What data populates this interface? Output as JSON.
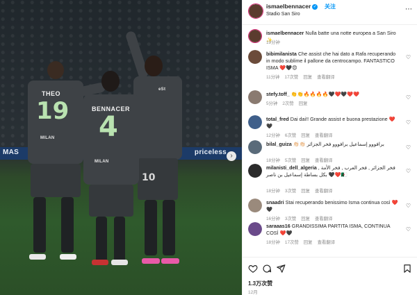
{
  "photo": {
    "board_left": "MAS",
    "board_right": "priceless",
    "players": {
      "left": {
        "name": "THEO",
        "number": "19",
        "sponsor": "MILAN"
      },
      "center": {
        "name": "BENNACER",
        "number": "4",
        "sponsor": "MILAN"
      },
      "right": {
        "number": "10",
        "sponsor": "eSt"
      }
    }
  },
  "header": {
    "username": "ismaelbennacer",
    "follow_label": "关注",
    "location": "Stadio San Siro"
  },
  "caption": {
    "username": "ismaelbennacer",
    "text": "Nulla batte una notte europea a San Siro ✨",
    "time": "19分钟"
  },
  "comments": [
    {
      "username": "bibimilanista",
      "text": "Che assist che hai dato a Rafa recuperando in modo sublime il pallone da centrocampo. FANTASTICO ISMA ❤️🖤😍",
      "time": "11分钟",
      "likes": "17次赞",
      "reply": "回复",
      "translate": "查看翻译",
      "avatar": "#6b4b3a"
    },
    {
      "username": "stefy.toff_",
      "text": "👏👏🔥🔥🔥🔥🖤❤️🖤❤️❤️",
      "time": "5分钟",
      "likes": "2次赞",
      "reply": "回复",
      "translate": "",
      "avatar": "#8a7a70"
    },
    {
      "username": "total_fred",
      "text": "Dai dai!! Grande assist e buona prestazione ❤️🖤",
      "time": "12分钟",
      "likes": "6次赞",
      "reply": "回复",
      "translate": "查看翻译",
      "avatar": "#3f5f8a"
    },
    {
      "username": "bilal_guiza",
      "text": "👏🏻👏🏻 برافووو إسماعيل برافووو فخر الجزائر",
      "time": "18分钟",
      "likes": "5次赞",
      "reply": "回复",
      "translate": "查看翻译",
      "avatar": "#5a6b7a"
    },
    {
      "username": "milanisti_dell_algeria",
      "text": "فخر الجزائر , فخر العرب , فخر الأمة , بكل بساطة إسماعيل بن ناصر 🖤❤️🇩🇿",
      "time": "18分钟",
      "likes": "3次赞",
      "reply": "回复",
      "translate": "查看翻译",
      "avatar": "#2b2b2b"
    },
    {
      "username": "snaadri",
      "text": "Stai recuperando benissimo Isma continua così ❤️🖤",
      "time": "16分钟",
      "likes": "3次赞",
      "reply": "回复",
      "translate": "查看翻译",
      "avatar": "#9a8a7c"
    },
    {
      "username": "saraaas16",
      "text": "GRANDISSIMA PARTITA ISMA, CONTINUA COSÌ ❤️🖤",
      "time": "18分钟",
      "likes": "17次赞",
      "reply": "回复",
      "translate": "查看翻译",
      "avatar": "#6a4a8a"
    }
  ],
  "trailing_comment": "...",
  "actions": {
    "likes": "1.3万次赞",
    "date": "12月"
  },
  "colors": {
    "accent": "#0095f6",
    "heart_red": "#e0245e",
    "pitch": "#2f5a2c"
  }
}
